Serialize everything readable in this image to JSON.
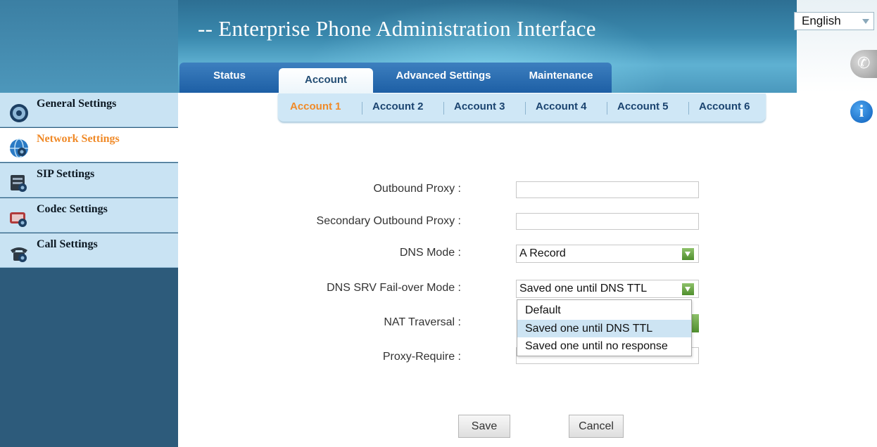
{
  "header": {
    "title": "-- Enterprise Phone Administration Interface",
    "language": "English"
  },
  "main_tabs": [
    {
      "label": "Status"
    },
    {
      "label": "Account"
    },
    {
      "label": "Advanced Settings"
    },
    {
      "label": "Maintenance"
    }
  ],
  "active_main_tab": "Account",
  "sidebar": {
    "items": [
      {
        "label": "General Settings"
      },
      {
        "label": "Network Settings"
      },
      {
        "label": "SIP Settings"
      },
      {
        "label": "Codec Settings"
      },
      {
        "label": "Call Settings"
      }
    ],
    "active": "Network Settings"
  },
  "sub_tabs": [
    {
      "label": "Account 1"
    },
    {
      "label": "Account 2"
    },
    {
      "label": "Account 3"
    },
    {
      "label": "Account 4"
    },
    {
      "label": "Account 5"
    },
    {
      "label": "Account 6"
    }
  ],
  "form": {
    "outbound_proxy_label": "Outbound Proxy :",
    "outbound_proxy_value": "",
    "secondary_proxy_label": "Secondary Outbound Proxy :",
    "secondary_proxy_value": "",
    "dns_mode_label": "DNS Mode :",
    "dns_mode_value": "A Record",
    "dns_srv_label": "DNS SRV Fail-over Mode :",
    "dns_srv_value": "Saved one until DNS TTL",
    "dns_srv_options": [
      "Default",
      "Saved one until DNS TTL",
      "Saved one until no response"
    ],
    "nat_label": "NAT Traversal :",
    "proxy_require_label": "Proxy-Require :"
  },
  "buttons": {
    "save": "Save",
    "cancel": "Cancel"
  },
  "colors": {
    "accent": "#f08a28",
    "sidebar_bg": "#2d5b7b",
    "select_button": "#6aa84f"
  }
}
